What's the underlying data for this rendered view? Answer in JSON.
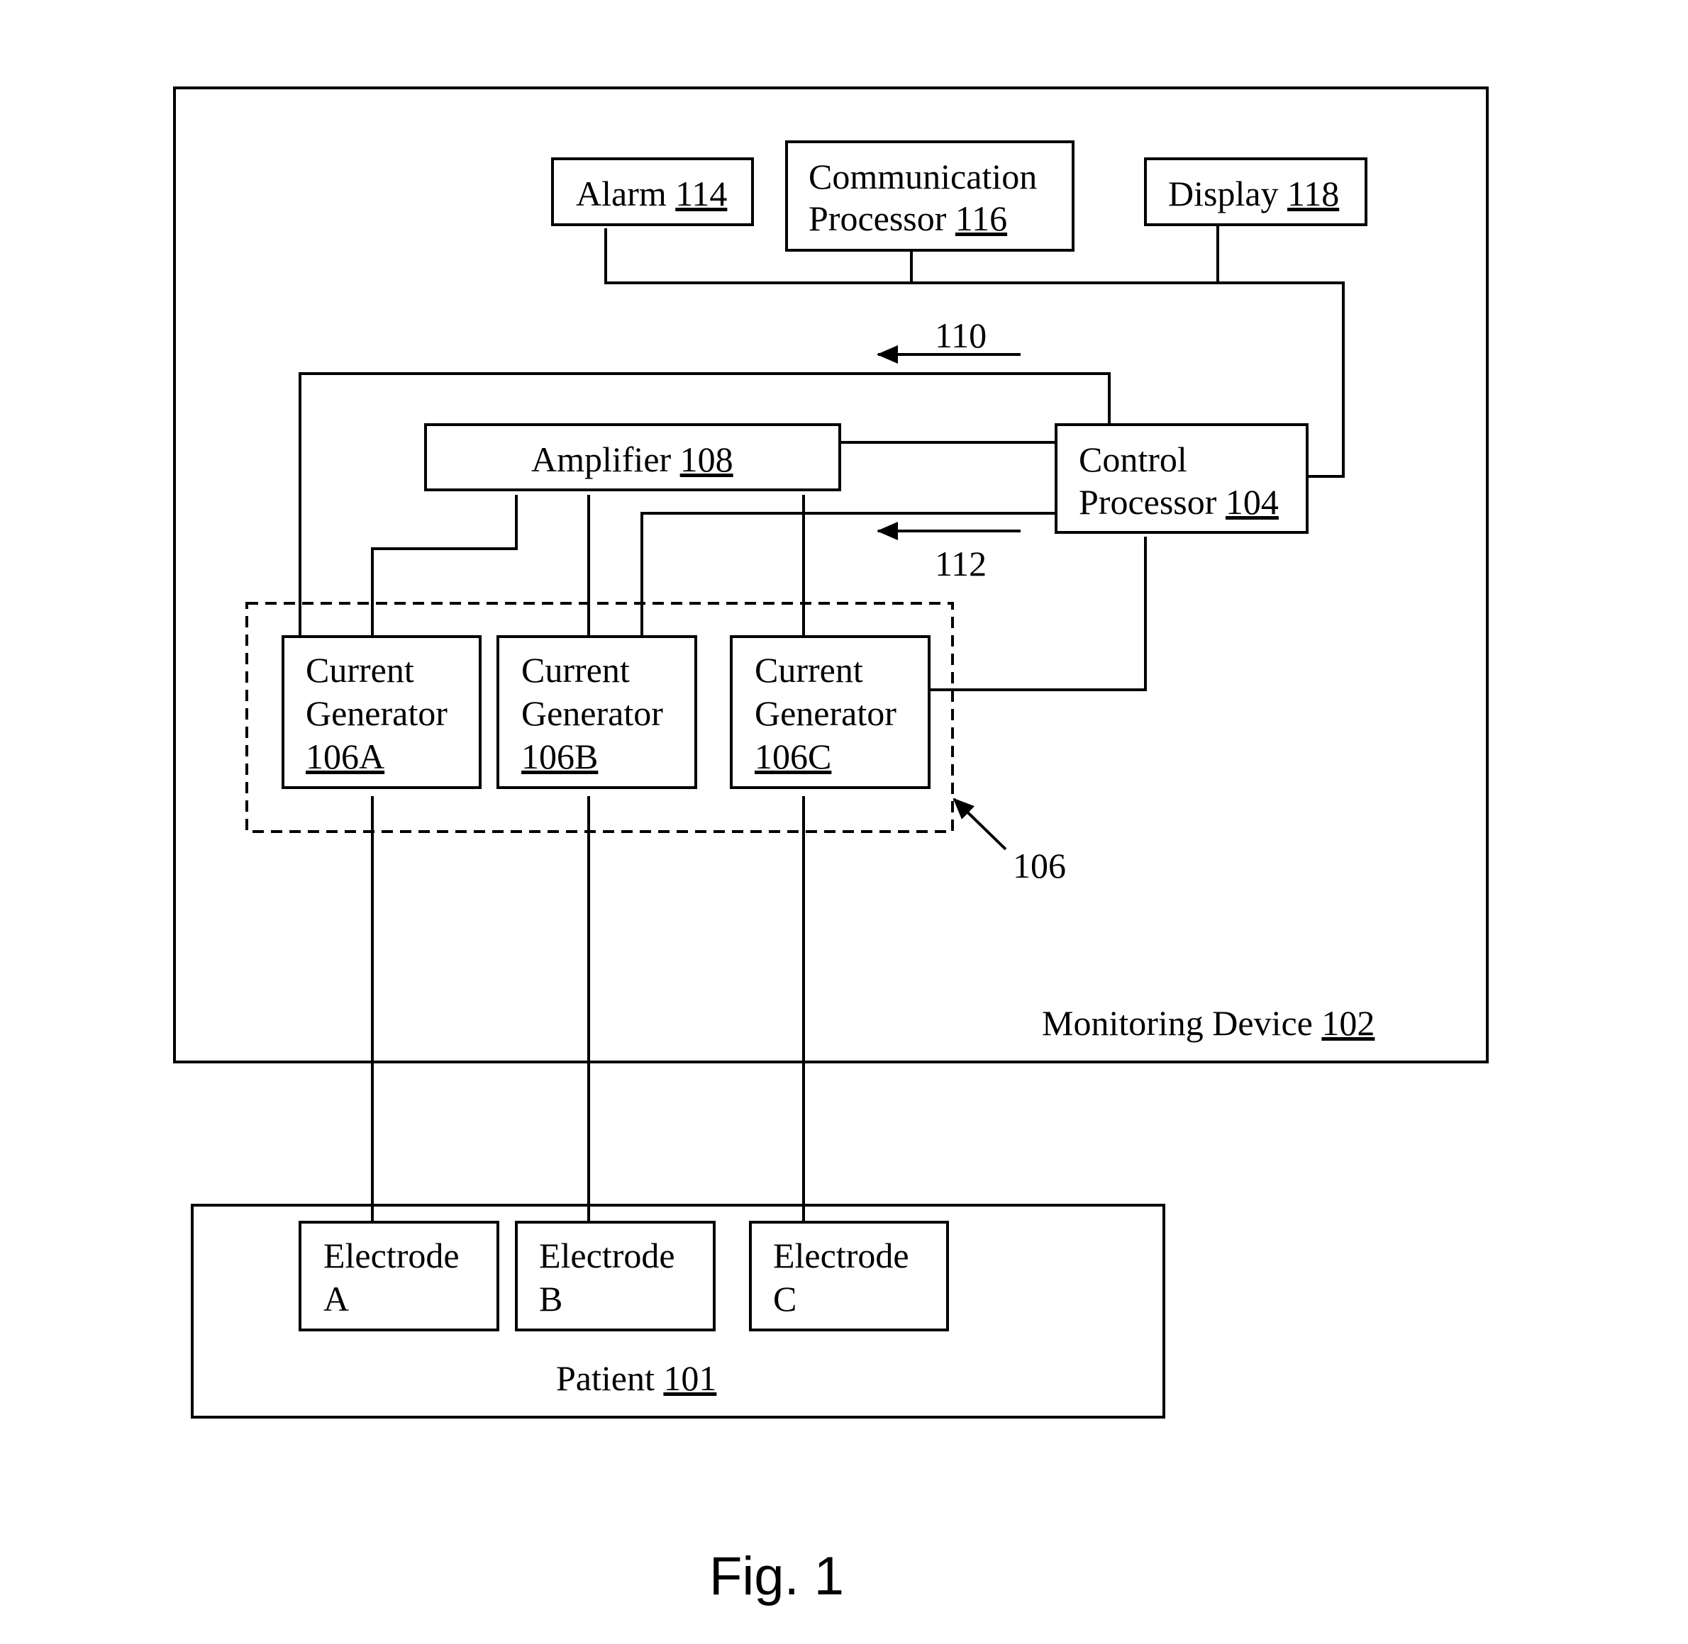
{
  "figure": {
    "caption": "Fig. 1",
    "monitoring_device": {
      "name": "Monitoring Device ",
      "ref": "102"
    },
    "patient": {
      "name": "Patient ",
      "ref": "101"
    },
    "alarm": {
      "name": "Alarm ",
      "ref": "114"
    },
    "communication_processor": {
      "line1": "Communication",
      "line2": "Processor ",
      "ref": "116"
    },
    "display": {
      "name": "Display ",
      "ref": "118"
    },
    "amplifier": {
      "name": "Amplifier ",
      "ref": "108"
    },
    "control_processor": {
      "line1": "Control",
      "line2": "Processor ",
      "ref": "104"
    },
    "current_generator_group": {
      "ref": "106"
    },
    "current_generators": [
      {
        "line1": "Current",
        "line2": "Generator",
        "ref": "106A"
      },
      {
        "line1": "Current",
        "line2": "Generator",
        "ref": "106B"
      },
      {
        "line1": "Current",
        "line2": "Generator",
        "ref": "106C"
      }
    ],
    "electrodes": [
      {
        "line1": "Electrode",
        "line2": "A"
      },
      {
        "line1": "Electrode",
        "line2": "B"
      },
      {
        "line1": "Electrode",
        "line2": "C"
      }
    ],
    "signals": {
      "forward": "110",
      "return": "112"
    }
  }
}
